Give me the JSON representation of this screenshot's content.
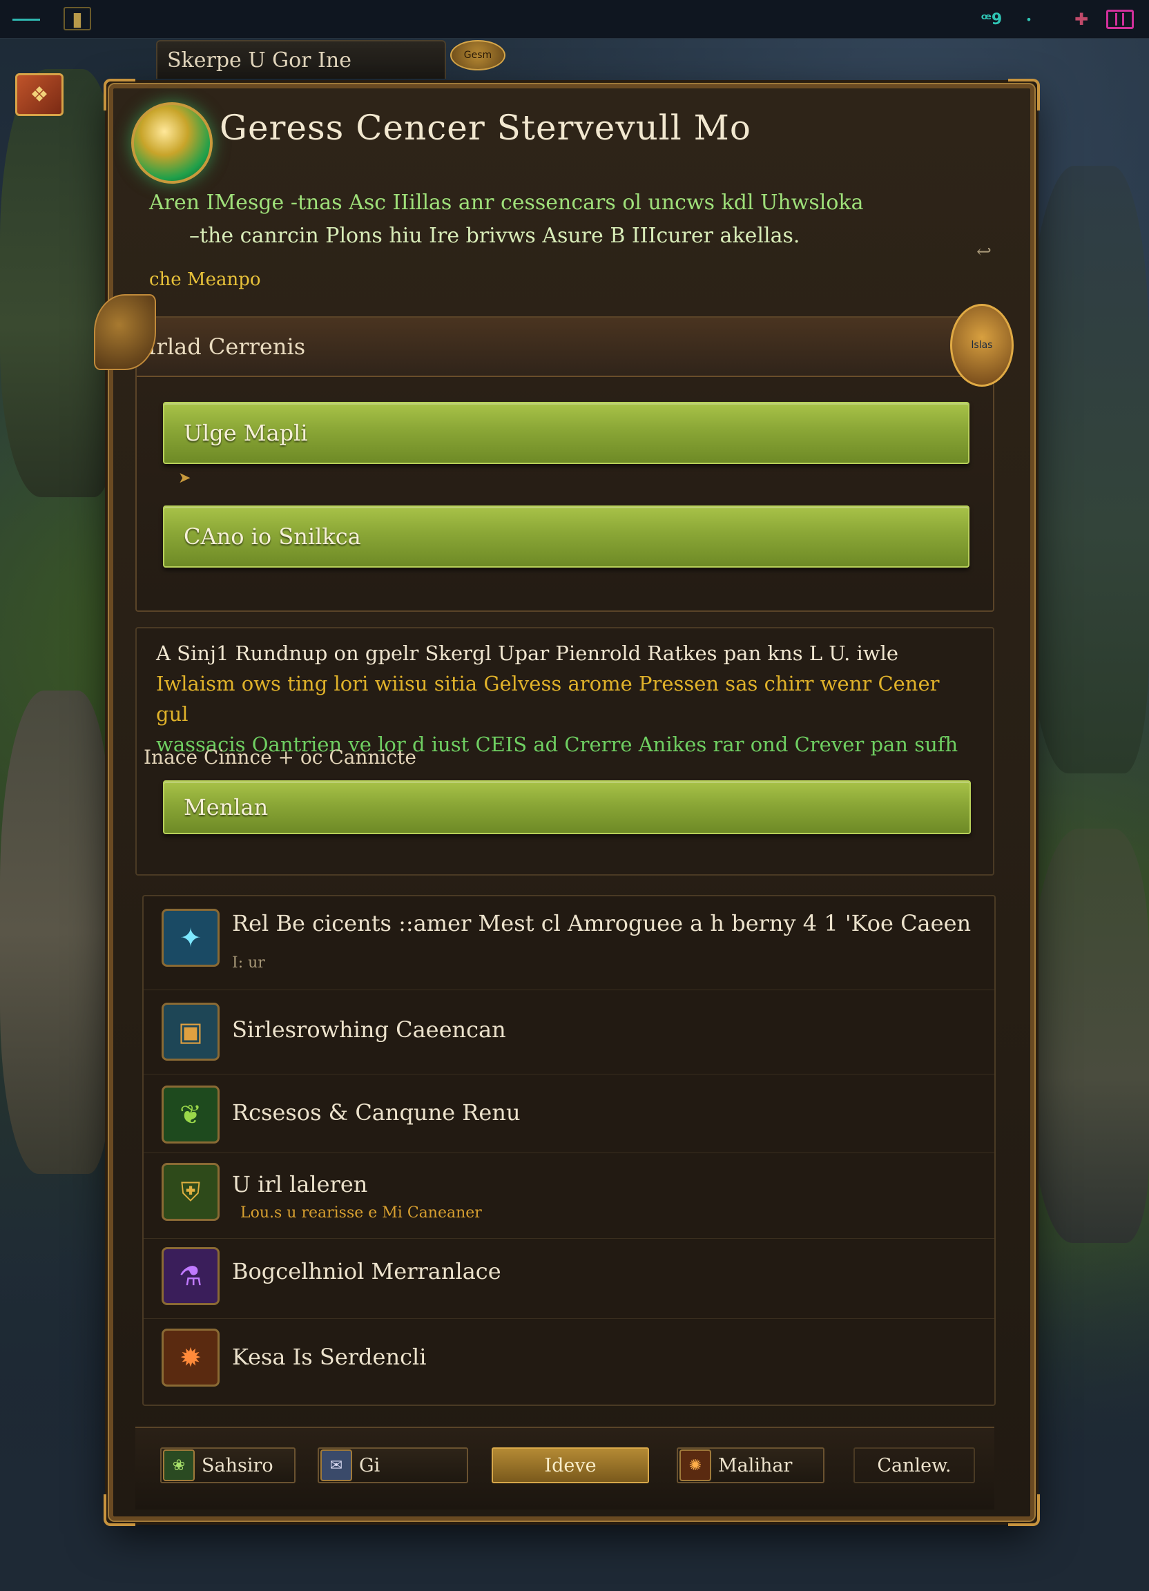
{
  "top_bar": {
    "left_icons": [
      "menu-icon",
      "book-icon"
    ],
    "status_text": "ꟹ9",
    "right_icons": [
      "gift-icon",
      "grid-icon"
    ]
  },
  "breadcrumb": {
    "label": "Skerpe U   Gor Ine",
    "badge": "Gesm"
  },
  "header": {
    "title": "Geress Cencer Stervevull Mo",
    "intro_line1": "Aren IMesge  -tnas  Asc  IIillas  anr  cessencars  ol uncws kdl  Uhwsloka",
    "intro_line2": "–the canrcin  Plons  hiu Ire brivws  Asure B IIIcurer  akellas.",
    "intro_sub": "che  Meanpo"
  },
  "section1": {
    "heading": "Irlad  Cerrenis",
    "ornament_label": "lslas",
    "buttons": [
      "Ulge Mapli",
      "CAno io Snilkca"
    ]
  },
  "section2": {
    "para_line1": "A Sinj1 Rundnup on gpelr  Skergl Upar  Pienrold  Ratkes pan kns  L U. iwle",
    "para_line2": "Iwlaism ows ting  lori wiisu  sitia Gelvess  arome Pressen sas chirr wenr  Cener gul",
    "para_line3": "wassacis Oantrien  ve lor d iust CEIS  ad Crerre  Anikes rar ond  Crever pan sufh",
    "label": "Inace  Cinnce + oc  Cannicte",
    "button": "Menlan"
  },
  "list": {
    "items": [
      {
        "label": "Rel Be cicents ::amer  Mest  cl  Amroguee  a h berny  4 1 'Koe  Caeen",
        "sub": "I: ur",
        "icon": "crystal-icon",
        "color": "#2a6a8a"
      },
      {
        "label": "Sirlesrowhing  Caeencan",
        "sub": "",
        "icon": "chest-icon",
        "color": "#2a5a6a"
      },
      {
        "label": "Rcsesos  &  Canqune  Renu",
        "sub": "",
        "icon": "leaf-icon",
        "color": "#2a5a22"
      },
      {
        "label": "U irl  laleren",
        "sub": "Lou.s u rearisse e  Mi  Caneaner",
        "icon": "shield-icon",
        "color": "#3a5a22"
      },
      {
        "label": "Bogcelhniol  Merranlace",
        "sub": "",
        "icon": "potion-icon",
        "color": "#4a2a6a"
      },
      {
        "label": "Kesa  Is  Serdencli",
        "sub": "",
        "icon": "flame-icon",
        "color": "#6a3a14"
      }
    ]
  },
  "footer": {
    "buttons": [
      {
        "label": "Sahsiro",
        "icon": "herb-icon"
      },
      {
        "label": "Gi",
        "icon": "scroll-icon"
      },
      {
        "label": "Ideve",
        "icon": ""
      },
      {
        "label": "Malihar",
        "icon": "fire-icon"
      },
      {
        "label": "Canlew.",
        "icon": ""
      }
    ]
  },
  "colors": {
    "accent_green": "#8aa636",
    "gold": "#c8943e",
    "frame": "#6a4a22"
  }
}
